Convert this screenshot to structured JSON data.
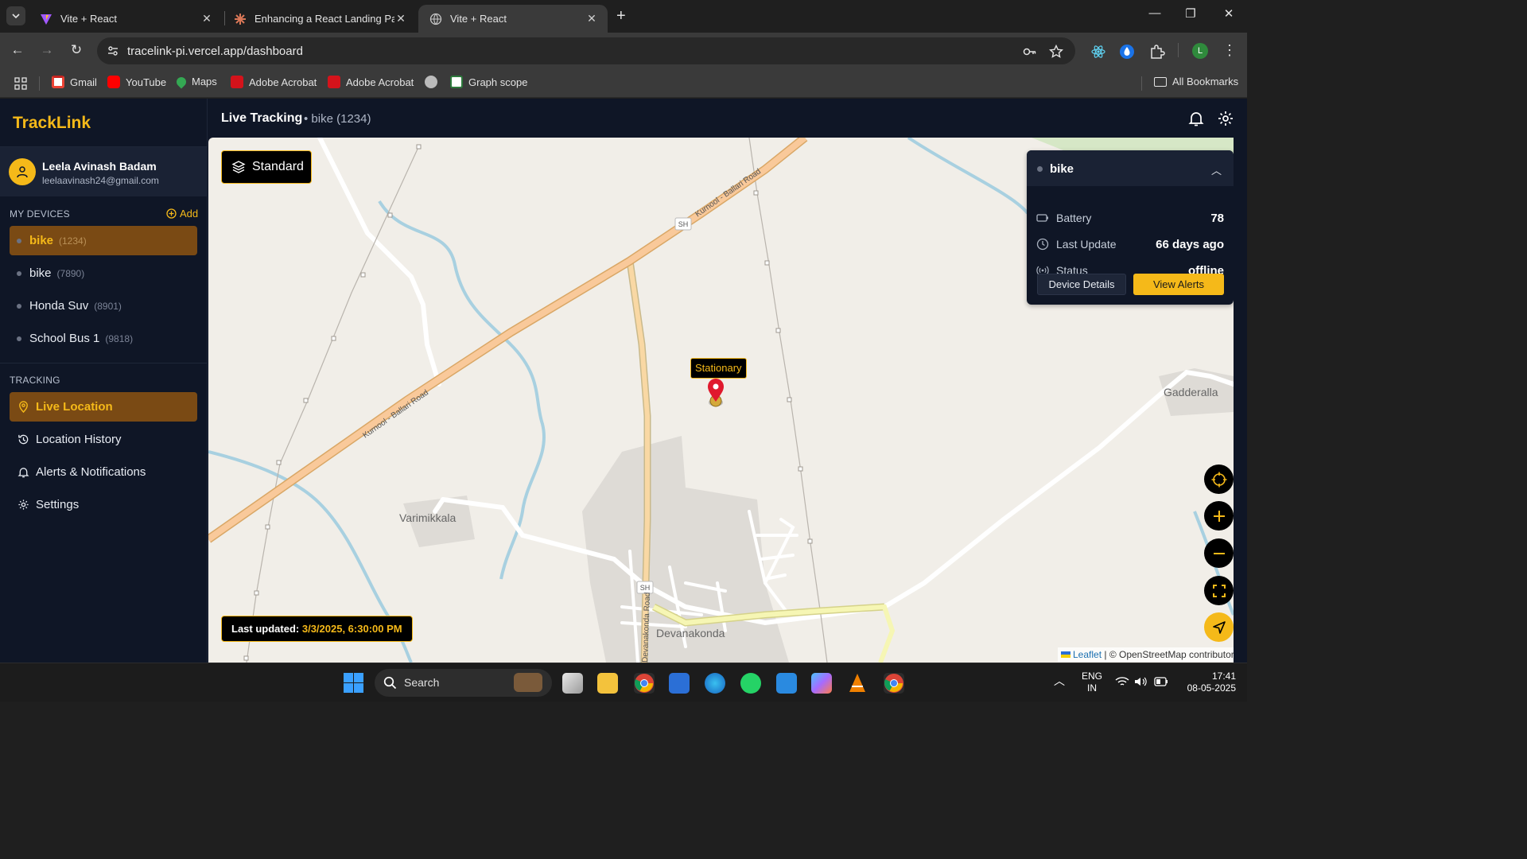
{
  "browser": {
    "tabs": [
      {
        "title": "Vite + React"
      },
      {
        "title": "Enhancing a React Landing Pag"
      },
      {
        "title": "Vite + React"
      }
    ],
    "url": "tracelink-pi.vercel.app/dashboard",
    "bookmarks": [
      {
        "label": "Gmail"
      },
      {
        "label": "YouTube"
      },
      {
        "label": "Maps"
      },
      {
        "label": "Adobe Acrobat"
      },
      {
        "label": "Adobe Acrobat"
      },
      {
        "label": "Graph scope"
      }
    ],
    "all_bookmarks": "All Bookmarks",
    "profile_initial": "L"
  },
  "app": {
    "brand": "TrackLink",
    "user": {
      "name": "Leela Avinash Badam",
      "email": "leelaavinash24@gmail.com"
    },
    "devices_title": "MY DEVICES",
    "add_label": "Add",
    "devices": [
      {
        "name": "bike",
        "code": "(1234)"
      },
      {
        "name": "bike",
        "code": "(7890)"
      },
      {
        "name": "Honda Suv",
        "code": "(8901)"
      },
      {
        "name": "School Bus 1",
        "code": "(9818)"
      }
    ],
    "tracking_title": "TRACKING",
    "nav": [
      {
        "label": "Live Location"
      },
      {
        "label": "Location History"
      },
      {
        "label": "Alerts & Notifications"
      },
      {
        "label": "Settings"
      }
    ],
    "header": {
      "title": "Live Tracking",
      "subtitle": "• bike (1234)"
    }
  },
  "map": {
    "layer_label": "Standard",
    "marker_label": "Stationary",
    "last_updated_label": "Last updated:",
    "last_updated_value": "3/3/2025, 6:30:00 PM",
    "attribution_leaflet": "Leaflet",
    "attribution_rest": " | © OpenStreetMap contributors",
    "places": [
      "Varimikkala",
      "Devanakonda",
      "Gadderalla"
    ],
    "roads": [
      "Kurnool - Ballari Road",
      "Kurnool - Ballari Road",
      "Devanakonda Road",
      "SH",
      "SH"
    ]
  },
  "device_card": {
    "name": "bike",
    "rows": [
      {
        "label": "Battery",
        "value": "78"
      },
      {
        "label": "Last Update",
        "value": "66 days ago"
      },
      {
        "label": "Status",
        "value": "offline"
      }
    ],
    "details_btn": "Device Details",
    "alerts_btn": "View Alerts"
  },
  "taskbar": {
    "search_label": "Search",
    "lang1": "ENG",
    "lang2": "IN",
    "time": "17:41",
    "date": "08-05-2025"
  },
  "colors": {
    "accent": "#f5b919",
    "sidebar": "#0f1626",
    "active_bg": "#7a4a14"
  }
}
